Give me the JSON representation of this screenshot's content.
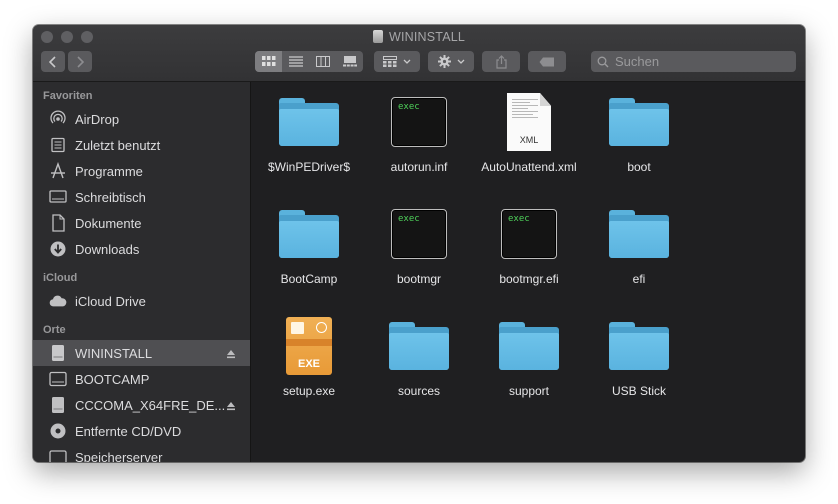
{
  "window": {
    "title": "WININSTALL"
  },
  "search": {
    "placeholder": "Suchen"
  },
  "sidebar": {
    "sections": [
      {
        "label": "Favoriten",
        "items": [
          {
            "label": "AirDrop",
            "icon": "airdrop-icon"
          },
          {
            "label": "Zuletzt benutzt",
            "icon": "recents-icon"
          },
          {
            "label": "Programme",
            "icon": "applications-icon"
          },
          {
            "label": "Schreibtisch",
            "icon": "desktop-icon"
          },
          {
            "label": "Dokumente",
            "icon": "documents-icon"
          },
          {
            "label": "Downloads",
            "icon": "downloads-icon"
          }
        ]
      },
      {
        "label": "iCloud",
        "items": [
          {
            "label": "iCloud Drive",
            "icon": "cloud-icon"
          }
        ]
      },
      {
        "label": "Orte",
        "items": [
          {
            "label": "WININSTALL",
            "icon": "disk-icon",
            "selected": true,
            "eject": true
          },
          {
            "label": "BOOTCAMP",
            "icon": "disk-icon"
          },
          {
            "label": "CCCOMA_X64FRE_DE...",
            "icon": "disk-icon",
            "eject": true
          },
          {
            "label": "Entfernte CD/DVD",
            "icon": "cd-icon"
          },
          {
            "label": "Speicherserver",
            "icon": "server-icon"
          }
        ]
      }
    ]
  },
  "files": [
    {
      "name": "$WinPEDriver$",
      "type": "folder"
    },
    {
      "name": "autorun.inf",
      "type": "exec",
      "badge": "exec"
    },
    {
      "name": "AutoUnattend.xml",
      "type": "xml",
      "badge": "XML"
    },
    {
      "name": "boot",
      "type": "folder"
    },
    {
      "name": "BootCamp",
      "type": "folder"
    },
    {
      "name": "bootmgr",
      "type": "exec",
      "badge": "exec"
    },
    {
      "name": "bootmgr.efi",
      "type": "exec",
      "badge": "exec"
    },
    {
      "name": "efi",
      "type": "folder"
    },
    {
      "name": "setup.exe",
      "type": "exe",
      "badge": "EXE"
    },
    {
      "name": "sources",
      "type": "folder"
    },
    {
      "name": "support",
      "type": "folder"
    },
    {
      "name": "USB Stick",
      "type": "folder"
    }
  ],
  "colors": {
    "window_bg": "#1f1f21",
    "sidebar_bg": "#2c2c2e",
    "folder": "#5ab3df",
    "selection": "#4f4f52"
  }
}
